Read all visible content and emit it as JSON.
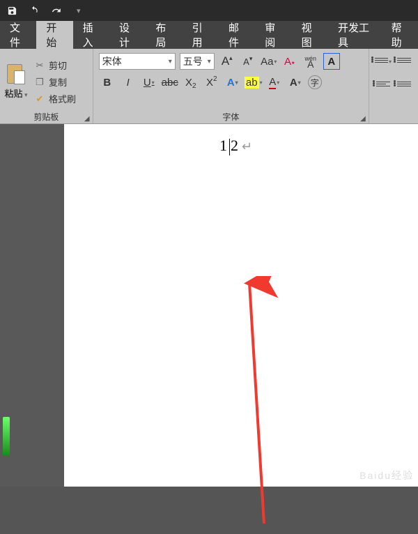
{
  "titlebar": {
    "icons": [
      "save",
      "undo",
      "redo"
    ]
  },
  "tabs": [
    "文件",
    "开始",
    "插入",
    "设计",
    "布局",
    "引用",
    "邮件",
    "审阅",
    "视图",
    "开发工具",
    "帮助"
  ],
  "activeTab": 1,
  "clipboard": {
    "paste": "粘贴",
    "cut": "剪切",
    "copy": "复制",
    "formatPainter": "格式刷",
    "groupLabel": "剪贴板"
  },
  "font": {
    "name": "宋体",
    "size": "五号",
    "groupLabel": "字体",
    "bold": "B",
    "italic": "I",
    "underline": "U",
    "strike": "abc",
    "sub": "X",
    "sup": "X",
    "growFont": "A",
    "shrinkFont": "A",
    "caseA": "Aa",
    "clearA": "A",
    "pinyin": "wén",
    "pinyinBase": "A",
    "borderA": "A",
    "accentA": "A",
    "highlightA": "ab",
    "underlineA": "A",
    "colorA": "A",
    "encA": "字"
  },
  "paragraph": {
    "groupLabel": ""
  },
  "document": {
    "text": "12",
    "paragraphMark": "↵"
  },
  "watermark": "Baidu经验"
}
